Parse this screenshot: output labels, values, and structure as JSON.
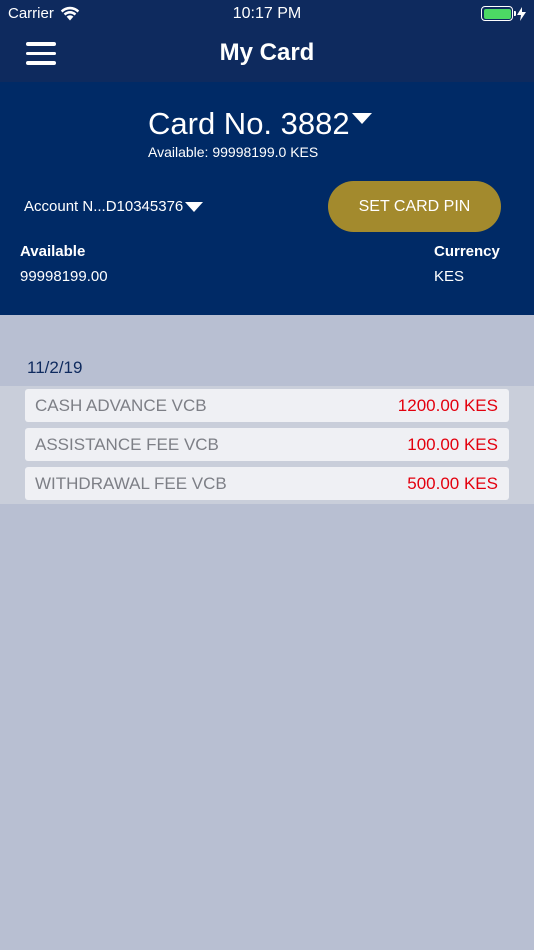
{
  "status_bar": {
    "carrier": "Carrier",
    "time": "10:17 PM"
  },
  "header": {
    "title": "My Card"
  },
  "card": {
    "number_label": "Card No. 3882",
    "available_text": "Available: 99998199.0 KES",
    "account_label": "Account N...D10345376",
    "set_pin_label": "SET CARD PIN",
    "available_heading": "Available",
    "available_value": "99998199.00",
    "currency_heading": "Currency",
    "currency_value": "KES"
  },
  "transactions": {
    "date": "11/2/19",
    "items": [
      {
        "description": "CASH ADVANCE  VCB",
        "amount": "1200.00 KES"
      },
      {
        "description": "ASSISTANCE FEE  VCB",
        "amount": "100.00 KES"
      },
      {
        "description": "WITHDRAWAL FEE  VCB",
        "amount": "500.00 KES"
      }
    ]
  },
  "colors": {
    "header_bg": "#0e2a5e",
    "panel_bg": "#002a66",
    "button_gold": "#a38a2d",
    "amount_red": "#e3000e",
    "content_bg": "#b8bfd2"
  }
}
